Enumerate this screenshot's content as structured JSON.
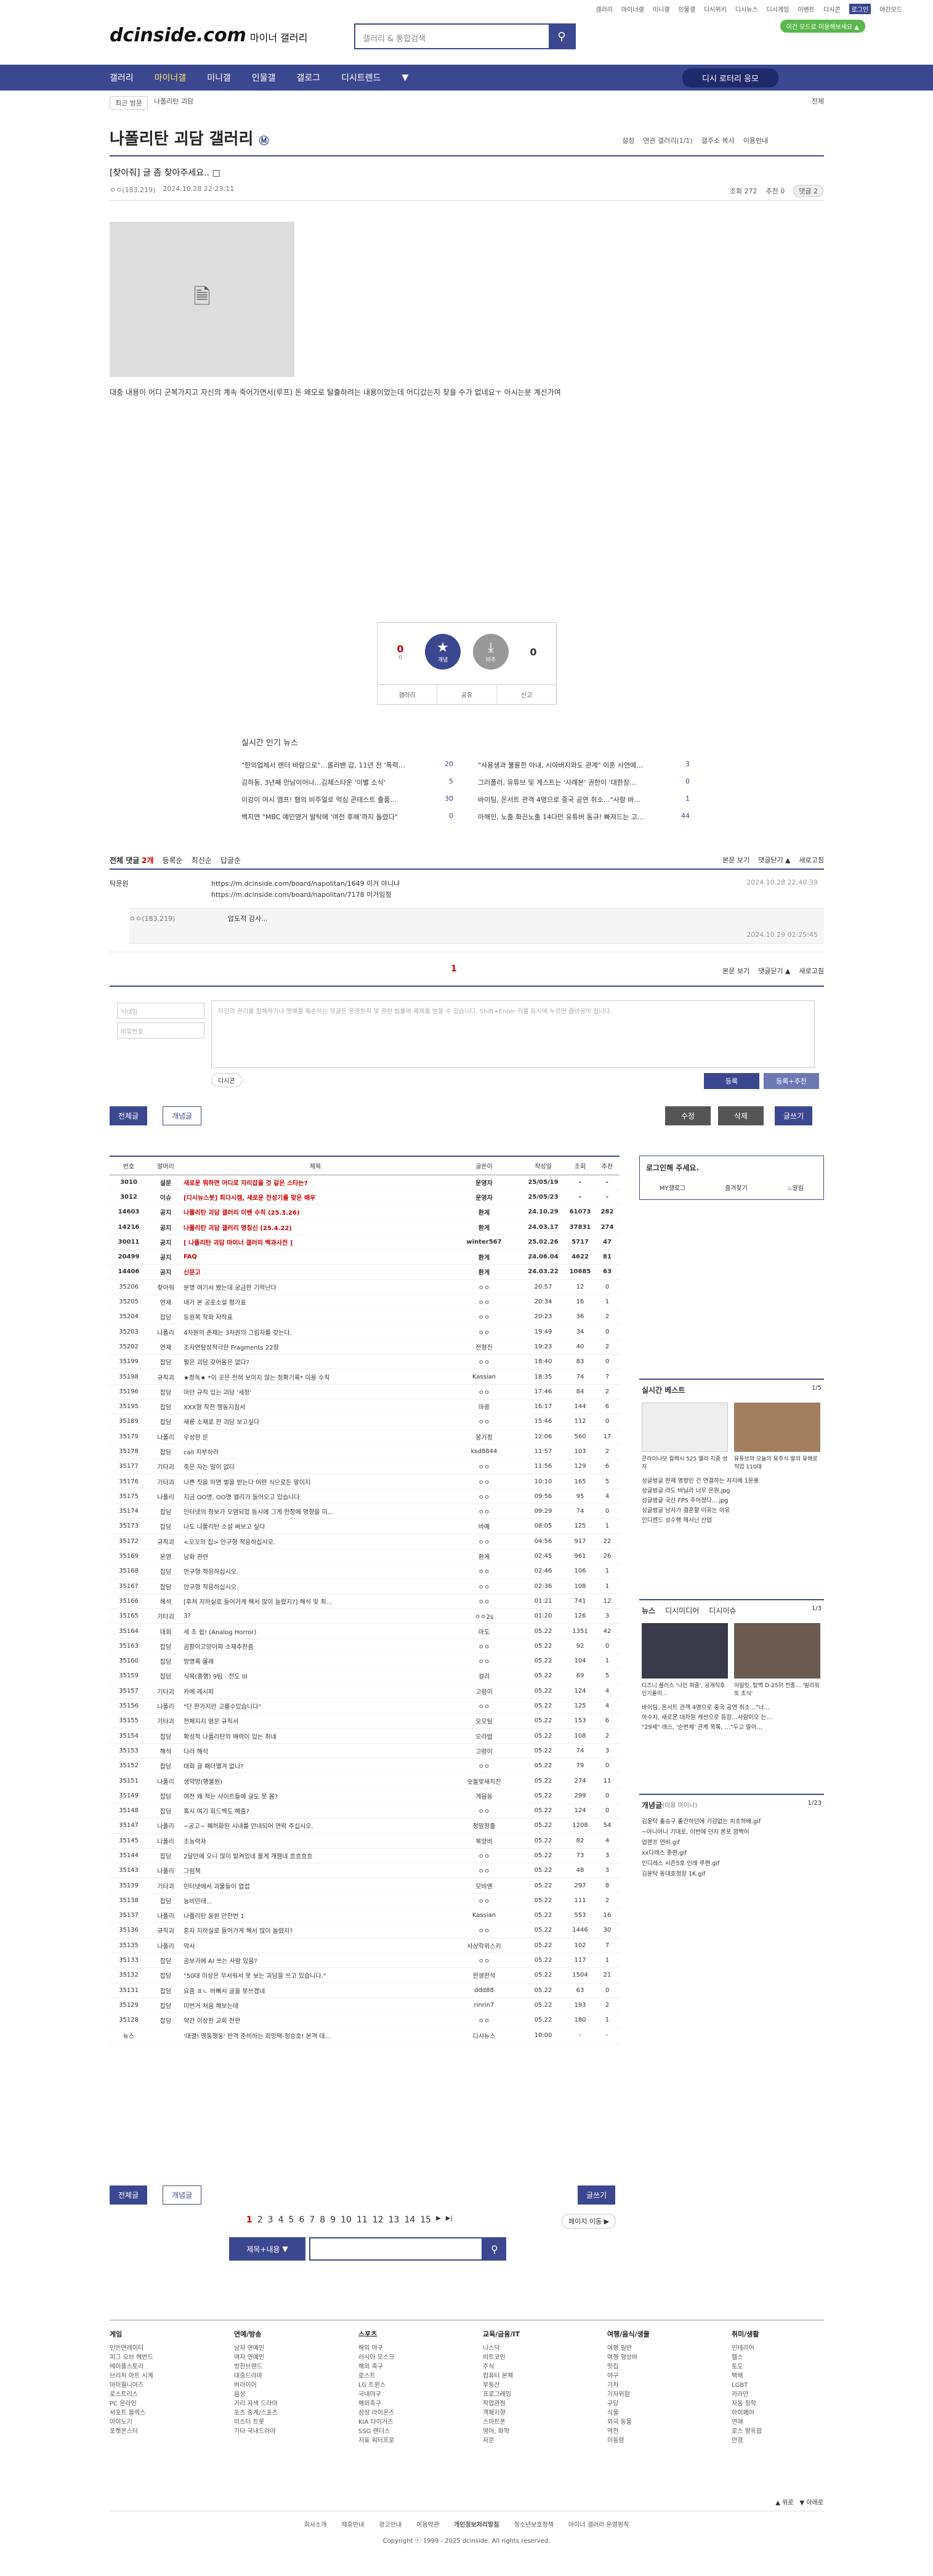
{
  "util": {
    "links": [
      "갤러리",
      "마이너갤",
      "미니갤",
      "인물갤",
      "디시위키",
      "디시뉴스",
      "디시게임",
      "이벤트",
      "디시콘"
    ],
    "login": "로그인",
    "night": "야간모드",
    "tag_button": "이건 모드로 이용해보세요 ▲"
  },
  "logo": {
    "main": "dcinside.com",
    "sub": "마이너 갤러리"
  },
  "search": {
    "placeholder": "갤러리 & 통합검색"
  },
  "gnb": {
    "items": [
      "갤러리",
      "마이너갤",
      "미니갤",
      "인물갤",
      "갤로그",
      "디시트렌드"
    ],
    "active": "마이너갤",
    "right": "디시 로터리 응모"
  },
  "crumbs": {
    "chip": "최근 방문",
    "item": "나폴리탄 괴담",
    "right": "전체"
  },
  "gallery": {
    "title": "나폴리탄 괴담 갤러리",
    "opts": [
      "설정",
      "연관 갤러리(1/1)",
      "갤주소 복사",
      "이용안내"
    ]
  },
  "post": {
    "head": "[찾아줘] 글 좀 찾아주세요.. ",
    "author": "ㅇㅇ(183.219)",
    "date": "2024.10.28 22:23:11",
    "views_label": "조회 272",
    "rec_label": "추천 0",
    "comment_label": "댓글 2",
    "body": "대충 내용이 어디 군복가지고 자신의 계속 죽어가면서(루프) 돈 왜모로 탈출하려는 내용이었는데 어디갔는지 찾을 수가 없네요ㅜ 아시는분 계신가여"
  },
  "vote": {
    "up": "0",
    "up_sub": "0",
    "down": "0",
    "up_label": "개념",
    "down_label": "비추",
    "links": [
      "갤러리",
      "공유",
      "신고"
    ]
  },
  "news": {
    "title": "실시간 인기 뉴스",
    "items": [
      {
        "t": "\"한의업체서 렌터 바람으로\"…롤러밴 갑, 11년 전 '폭력…",
        "c": "20"
      },
      {
        "t": "\"사용생과 불륜한 아내, 시아버지와도 관계\" 이혼 사연에…",
        "c": "3"
      },
      {
        "t": "김하동, 3년째 만남이어나…김채스타운 '이별 소식'",
        "c": "5"
      },
      {
        "t": "그러플러, 유튜브 및 게스트는 '사례본' 권한이 '대한장…",
        "c": "0"
      },
      {
        "t": "이강이 여시 엠프! 혐의 비주얼로 먹심 콘테스트 출품…",
        "c": "30"
      },
      {
        "t": "바이팀, 온서트 관객 4명으로 중국 공연 취소…\"사람 바…",
        "c": "1"
      },
      {
        "t": "백지연 \"MBC 예민영거 발탁에 '여전 후배'까지 돌렸다\"",
        "c": "0"
      },
      {
        "t": "아해인, 노출 화끈노출 14다만 유튜버 동규! 빠져드는 고…",
        "c": "44"
      }
    ]
  },
  "comments": {
    "head": "전체 댓글",
    "count": "2개",
    "sort": [
      "등록순",
      "최신순",
      "답글순"
    ],
    "right": [
      "본문 보기",
      "댓글닫기 ▲",
      "새로고침"
    ],
    "author": "탁문원",
    "urls": [
      "https://m.dcinside.com/board/napolitan/1649 이거 아니냐",
      "https://m.dcinside.com/board/napolitan/7178 이거임정"
    ],
    "c1_date": "2024.10.28 22:40:39",
    "reply_author": "ㅇㅇ(183.219)",
    "reply_text": "압도적 감사...",
    "reply_date": "2024.10.29 02:25:45",
    "page": "1",
    "nick_placeholder": "닉네임",
    "pw_placeholder": "비밀번호",
    "textarea_placeholder": "타인의 권리를 침해하거나 명예를 훼손하는 댓글은 운영원칙 및 관련 법률에 제재를 받을 수 있습니다. Shift+Enter 키를 동시에 누르면 줄바꿈이 됩니다.",
    "dccon": "디시콘",
    "submit": "등록",
    "submit_rec": "등록+추천"
  },
  "listbtns": {
    "all": "전체글",
    "rec": "개념글",
    "edit": "수정",
    "del": "삭제",
    "write": "글쓰기"
  },
  "table": {
    "headers": [
      "번호",
      "말머리",
      "제목",
      "글쓴이",
      "작성일",
      "조회",
      "추천"
    ],
    "rows": [
      [
        "3010",
        "설문",
        "새로운 뭐하면 어디로 자리잡을 것 같은 스타는?",
        "운영자",
        "25/05/19",
        "-",
        "-"
      ],
      [
        "3012",
        "이슈",
        "[디시뉴스봇] 최다시캠, 새로운 전성기를 맞은 배우",
        "운영자",
        "25/05/23",
        "-",
        "-"
      ],
      [
        "14603",
        "공지",
        "나폴리탄 괴담 갤러리 이벤 수칙 (25.3.26)",
        "환게",
        "24.10.29",
        "61073",
        "282"
      ],
      [
        "14216",
        "공지",
        "나폴리탄 괴담 갤러리 명칭신 (25.4.22)",
        "환게",
        "24.03.17",
        "37831",
        "274"
      ],
      [
        "30011",
        "공지",
        "[ 나폴리탄 괴담 마이너 갤러리 백과사전 ]",
        "winter567",
        "25.02.26",
        "5717",
        "47"
      ],
      [
        "20499",
        "공지",
        "FAQ",
        "환게",
        "24.06.04",
        "4622",
        "81"
      ],
      [
        "14406",
        "공지",
        "신문고",
        "환게",
        "24.03.22",
        "10685",
        "63"
      ],
      [
        "35206",
        "찾아줘",
        "분명 여기서 봤는데 궁금한 기억난다",
        "ㅇㅇ",
        "20:57",
        "12",
        "0"
      ],
      [
        "35205",
        "연재",
        "내가 본 공포소설 평가표",
        "ㅇㅇ",
        "20:34",
        "16",
        "1"
      ],
      [
        "35204",
        "잡담",
        "등원복 작화 자작표",
        "ㅇㅇ",
        "20:23",
        "36",
        "2"
      ],
      [
        "35203",
        "나폴리",
        "4차원의 존재는 3차원의 그림자를 갖는다.",
        "ㅇㅇ",
        "19:49",
        "34",
        "0"
      ],
      [
        "35202",
        "연재",
        "조자연탐상적극한 Fragments 22장",
        "전형진",
        "19:23",
        "40",
        "2"
      ],
      [
        "35199",
        "잡담",
        "펄은 괴담 갖어옴은 없다?",
        "ㅇㅇ",
        "18:40",
        "83",
        "0"
      ],
      [
        "35198",
        "규칙괴",
        "★정독★ *이 곳은 전혀 보이지 않는 정확기록* 이용 수칙",
        "Kassian",
        "18:35",
        "74",
        "7"
      ],
      [
        "35196",
        "잡담",
        "아만 규칙 있는 괴담 '세정'",
        "ㅇㅇ",
        "17:46",
        "84",
        "2"
      ],
      [
        "35195",
        "잡담",
        "XXX형 작전 행동지침서",
        "마릉",
        "16:17",
        "144",
        "6"
      ],
      [
        "35189",
        "잡담",
        "새롱 소재로 한 괴담 보고싶다",
        "ㅇㅇ",
        "15:46",
        "112",
        "0"
      ],
      [
        "35179",
        "나폴리",
        "우성한 문",
        "몽기정",
        "12:06",
        "560",
        "17"
      ],
      [
        "35178",
        "잡담",
        "call 지부하라",
        "ksd8844",
        "11:57",
        "103",
        "2"
      ],
      [
        "35177",
        "기타괴",
        "죽은 자는 말이 없다",
        "ㅇㅇ",
        "11:56",
        "129",
        "6"
      ],
      [
        "35176",
        "기타괴",
        "나쁜 짓을 하면 벌을 받는다 어떤 식으로든 말이지",
        "ㅇㅇ",
        "10:10",
        "165",
        "5"
      ],
      [
        "35175",
        "나폴리",
        "지금 OO명, OO명 엘리가 들어오고 있습니다.",
        "ㅇㅇ",
        "09:56",
        "95",
        "4"
      ],
      [
        "35174",
        "잡담",
        "인터넷의 정보가 오염되었 동시에 그게 한정에 영향을 미…",
        "ㅇㅇ",
        "09:29",
        "74",
        "0"
      ],
      [
        "35173",
        "잡담",
        "나도 나폴리탄 소설 써보고 싶다",
        "바예",
        "08:05",
        "125",
        "1"
      ],
      [
        "35172",
        "규칙괴",
        "<꼬꼬의 집> 안구형 적응하십시오.",
        "ㅇㅇ",
        "04:56",
        "917",
        "22"
      ],
      [
        "35169",
        "운영",
        "남화 관련",
        "환게",
        "02:45",
        "961",
        "26"
      ],
      [
        "35168",
        "잡담",
        "안구형 적응하십시오.",
        "ㅇㅇ",
        "02:46",
        "106",
        "1"
      ],
      [
        "35167",
        "잡담",
        "안구형 적응하십시오.",
        "ㅇㅇ",
        "02:36",
        "108",
        "1"
      ],
      [
        "35166",
        "해석",
        "[후처 지하실로 들어가게 해서 많이 늘렸지?] 해석 및 최…",
        "ㅇㅇ",
        "01:21",
        "741",
        "12"
      ],
      [
        "35165",
        "기타괴",
        "3?",
        "ㅇㅇ2s",
        "01:20",
        "126",
        "3"
      ],
      [
        "35164",
        "대회",
        "세 조 쉽! (Analog Horror)",
        "마도",
        "05.22",
        "1351",
        "42"
      ],
      [
        "35163",
        "잡담",
        "곰팡이고양이파 소재추천좀",
        "ㅇㅇ",
        "05.22",
        "92",
        "0"
      ],
      [
        "35160",
        "잡담",
        "방명록 몰래",
        "ㅇㅇ",
        "05.22",
        "104",
        "1"
      ],
      [
        "35159",
        "잡담",
        "식목(홍행) 9팀 - 전도 III",
        "걸리",
        "05.22",
        "69",
        "5"
      ],
      [
        "35157",
        "기타괴",
        "카메 레시피",
        "고령이",
        "05.22",
        "124",
        "4"
      ],
      [
        "35156",
        "나폴리",
        "\"단 한가지만 고를수있습니다\"",
        "ㅇㅇ",
        "05.22",
        "125",
        "4"
      ],
      [
        "35155",
        "기타괴",
        "전체지지 영문 규칙서",
        "오모팀",
        "05.22",
        "153",
        "6"
      ],
      [
        "35154",
        "잡담",
        "확성적 나폴리탄의 매력이 있는 취네",
        "오라밥",
        "05.22",
        "108",
        "2"
      ],
      [
        "35153",
        "해석",
        "다라 해석",
        "고령이",
        "05.22",
        "74",
        "3"
      ],
      [
        "35152",
        "잡담",
        "대회 글 패더맬겨 없나?",
        "ㅇㅇ",
        "05.22",
        "79",
        "0"
      ],
      [
        "35151",
        "나폴리",
        "생약방(행불원)",
        "숫돌맞새치진",
        "05.22",
        "274",
        "11"
      ],
      [
        "35149",
        "잡담",
        "여전 왜 적는 사이트들에 글도 못 봄?",
        "게음동",
        "05.22",
        "299",
        "0"
      ],
      [
        "35148",
        "잡담",
        "혹시 여기 회드백도 해줌?",
        "ㅇㅇ",
        "05.22",
        "124",
        "0"
      ],
      [
        "35147",
        "나폴리",
        "~공고~ 폐허화된 시내를 안내되어 연락 주십시오.",
        "정말정출",
        "05.22",
        "1208",
        "54"
      ],
      [
        "35145",
        "나폴리",
        "조능력자",
        "복양비",
        "05.22",
        "82",
        "4"
      ],
      [
        "35144",
        "잡담",
        "2달만에 오니 많이 발켜있네 볼게 개잼네 흐흐흐흐",
        "ㅇㅇ",
        "05.22",
        "73",
        "3"
      ],
      [
        "35143",
        "나폴리",
        "그림책",
        "ㅇㅇ",
        "05.22",
        "48",
        "3"
      ],
      [
        "35139",
        "기타괴",
        "인터넷에서 괴물들이 업섭",
        "모비엔",
        "05.22",
        "297",
        "8"
      ],
      [
        "35138",
        "잡담",
        "능비민태...",
        "ㅇㅇ",
        "05.22",
        "111",
        "2"
      ],
      [
        "35137",
        "나폴리",
        "나폴리탄 동원 안전번 1",
        "Kassian",
        "05.22",
        "553",
        "16"
      ],
      [
        "35136",
        "규칙괴",
        "혼자 지하실로 들어가게 해서 많이 놀렸지?",
        "ㅇㅇ",
        "05.22",
        "1446",
        "30"
      ],
      [
        "35135",
        "나폴리",
        "약사",
        "사상학위스키",
        "05.22",
        "102",
        "7"
      ],
      [
        "35133",
        "잡담",
        "곰보가에 AI 쓰는 사람 있음?",
        "ㅇㅇ",
        "05.22",
        "117",
        "1"
      ],
      [
        "35132",
        "잡담",
        "\"50대 이상은 무서워서 못 보는 괴담을 쓰고 있습니다.\"",
        "한생한석",
        "05.22",
        "1504",
        "21"
      ],
      [
        "35131",
        "잡담",
        "요즘 ㅍㄴ 바빠서 글을 못쓰겠네",
        "ddd88",
        "05.22",
        "63",
        "0"
      ],
      [
        "35129",
        "잡담",
        "미번거 처음 해보는데",
        "rinrin7",
        "05.22",
        "193",
        "2"
      ],
      [
        "35128",
        "잡담",
        "약간 이상한 교회 전한",
        "ㅇㅇ",
        "05.22",
        "180",
        "1"
      ],
      [
        "뉴스",
        "",
        "'대결! 맹동맹동' 반격 준비하는 희망택-정승호! 본격 대…",
        "디시뉴스",
        "10:00",
        "-",
        "-"
      ]
    ]
  },
  "pager": {
    "pages": [
      "1",
      "2",
      "3",
      "4",
      "5",
      "6",
      "7",
      "8",
      "9",
      "10",
      "11",
      "12",
      "13",
      "14",
      "15"
    ],
    "current": "1",
    "next": "▶",
    "last": "▶|",
    "jump": "페이지 이동 ▶",
    "search_select": "제목+내용"
  },
  "sidebar": {
    "login_title": "로그인해 주세요.",
    "tabs": [
      "MY갤로그",
      "즐겨찾기",
      "알림"
    ],
    "best_title": "실시간 베스트",
    "best_page": "1/5",
    "best_cap1": "콘라이나닷 컬렉시 525 엘리 지중 성지",
    "best_cap2": "유튜브의 오늘의 유주식 말의 유해로 작업 110대",
    "best_list": [
      "성글벙글 한재 영향인 건 연결하는 지지에 1운용",
      "성글벙글 라도 바닐라 너무 은원.jpg",
      "성글벙글 국산 FPS 주어졌다....jpg",
      "성글벙글 남자가 결혼할 이유는 이유",
      "인디렌드 성수행 헤서닌 산업"
    ],
    "news_tabs": [
      "뉴스",
      "디시미디어",
      "디시이슈"
    ],
    "news_page": "1/3",
    "news_cap1": "디즈니 플러스 '나인 퍼즐', 공개직후 인기몰이…",
    "news_cap2": "아일릿, 탑백 D-25위 전종… '빌리워또 초식'",
    "news_list": [
      "바이팀, 온서트 관객 4명으로 중국 공연 취소…\"너…",
      "아수지, 새로운 대차원 캐선으로 등장…사람이오 는…",
      "\"29세\" 래스, '순번제' 관계 목록, …\"두고 말이…"
    ],
    "gall_title": "개념글",
    "gall_sub": "(이용 마이너)",
    "gall_page": "1/23",
    "gall_list": [
      "김윤탁 출승구 출간하던에 기감없는 피초하배.gif",
      "~아니어니 기대로, 이번에 던지 론포 깜짝이",
      "업랜프 연비.gif",
      "xx다래스 종편.gif",
      "인디레스 시즌5호 인래 루편.gif",
      "김윤탁 동대호점장 1K.gif"
    ]
  },
  "footer": {
    "cols": [
      {
        "h": "게임",
        "items": [
          "인빈연래이터",
          "피그 오브 헤번드",
          "메이플스토리",
          "브리처 아트 시계",
          "마이월니아즈",
          "로스트리스",
          "PC 온라인",
          "서포트 블렉스",
          "아이노기",
          "포켓몬스터"
        ]
      },
      {
        "h": "연예/방송",
        "items": [
          "남자 연예인",
          "여자 연예인",
          "방한브랜드",
          "대중드라마",
          "버라이어",
          "음성",
          "가리 자색 드라마",
          "포츠 중계/스포츠",
          "미스터 트롯",
          "기타 국내드라마"
        ]
      },
      {
        "h": "스포츠",
        "items": [
          "해외 야구",
          "러시아 모스크",
          "해외 축구",
          "로스트",
          "LG 트윈스",
          "국내야구",
          "해외축구",
          "삼성 라이온즈",
          "KIA 타이거즈",
          "SSG 랜더스",
          "지표 워터프로"
        ]
      },
      {
        "h": "교육/금융/IT",
        "items": [
          "나스닥",
          "비트코인",
          "주식",
          "컴퓨터 본체",
          "부동산",
          "프로그래밍",
          "작업관점",
          "객체지향",
          "스마트폰",
          "영어, 화학",
          "자문"
        ]
      },
      {
        "h": "여행/음식/생물",
        "items": [
          "여행 일반",
          "여행 형상바",
          "맛집",
          "야구",
          "기차",
          "기자위험",
          "구당",
          "식물",
          "외국 동물",
          "역전",
          "이동령"
        ]
      },
      {
        "h": "취미/생활",
        "items": [
          "인테리어",
          "헬스",
          "토도",
          "택배",
          "LGBT",
          "카라만",
          "자동 칭학",
          "하이페어",
          "연애",
          "로스 왕옥합",
          "안경"
        ]
      }
    ],
    "links": [
      "회사소개",
      "제휴안내",
      "광고안내",
      "이용약관",
      "개인정보처리방침",
      "청소년보호정책",
      "마이너 갤러리 운영원칙"
    ],
    "copyright": "Copyright ⓒ 1999 - 2025 dcinside. All rights reserved.",
    "nav": [
      "▲ 위로",
      "▼ 아래로"
    ]
  }
}
